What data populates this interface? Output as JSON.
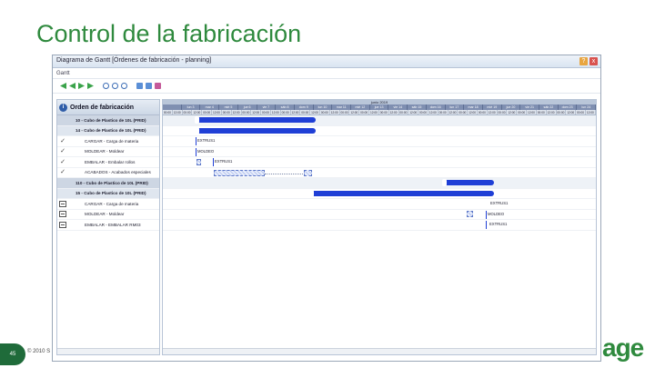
{
  "slide": {
    "title": "Control de la fabricación",
    "page_number": "45",
    "copyright": "© 2010 S",
    "logo_text": "age"
  },
  "window": {
    "title": "Diagrama de Gantt [Órdenes de fabricación - planning]",
    "menu": "Gantt",
    "buttons": {
      "help": "?",
      "close": "x"
    }
  },
  "toolbar": {
    "icons": [
      "first-icon",
      "prev-icon",
      "next-icon",
      "last-icon",
      "zoom-in-icon",
      "zoom-out-icon",
      "zoom-fit-icon",
      "settings-icon",
      "filter-icon",
      "print-icon"
    ]
  },
  "left_panel": {
    "header": "Orden de fabricación",
    "rows": [
      {
        "label": "10 - Cubo de Plastico de 10L (PRID)",
        "kind": "order",
        "icon": ""
      },
      {
        "label": "14 - Cubo de Plastico de 10L (PRID)",
        "kind": "sub",
        "icon": ""
      },
      {
        "label": "CARGAR - Carga de materia",
        "kind": "task",
        "icon": "✓"
      },
      {
        "label": "MOLDEAR - Moldear",
        "kind": "task",
        "icon": "✓"
      },
      {
        "label": "EMBALAR - Embalar rollos",
        "kind": "task",
        "icon": "✓"
      },
      {
        "label": "ACABADOS - Acabados especiales",
        "kind": "task",
        "icon": "✓"
      },
      {
        "label": "110 - Cubo de Plastico de 10L (PRID)",
        "kind": "order",
        "icon": ""
      },
      {
        "label": "15 - Cubo de Plastico de 10L (PRID)",
        "kind": "sub",
        "icon": ""
      },
      {
        "label": "CARGAR - Carga de materia",
        "kind": "task",
        "icon": "box"
      },
      {
        "label": "MOLDEAR - Moldear",
        "kind": "task",
        "icon": "box"
      },
      {
        "label": "EMBALAR - EMBALAR RM03",
        "kind": "task",
        "icon": "box"
      }
    ]
  },
  "timeline": {
    "month": "junio 2019",
    "days": [
      "",
      "lun 3",
      "mar 4",
      "mié 5",
      "jue 6",
      "vie 7",
      "sáb 8",
      "dom 9",
      "lun 10",
      "mar 11",
      "mié 12",
      "jue 13",
      "vie 14",
      "sáb 15",
      "dom 16",
      "lun 17",
      "mar 18",
      "mié 19",
      "jue 20",
      "vie 21",
      "sáb 22",
      "dom 23",
      "lun 24"
    ],
    "hours": [
      "00:00",
      "12:00",
      "00:00",
      "12:00",
      "00:00",
      "12:00",
      "00:00",
      "12:00",
      "00:00",
      "12:00",
      "00:00",
      "12:00",
      "00:00",
      "12:00",
      "00:00",
      "12:00",
      "00:00",
      "12:00",
      "00:00",
      "12:00",
      "00:00",
      "12:00",
      "00:00",
      "12:00",
      "00:00",
      "12:00",
      "00:00",
      "12:00",
      "00:00",
      "12:00",
      "00:00",
      "12:00",
      "00:00",
      "12:00",
      "00:00",
      "12:00",
      "00:00",
      "12:00",
      "00:00",
      "12:00",
      "00:00",
      "12:00",
      "00:00",
      "12:00"
    ]
  },
  "gantt_labels": {
    "r3": "EXTRUS1",
    "r4": "MOLDEO",
    "r5": "EXTRUS1",
    "r9": "EXTRUS1",
    "r10": "MOLDEO",
    "r11": "EXTRUS1"
  },
  "colors": {
    "accent": "#2f8a3e",
    "bar": "#1f3fd6",
    "header": "#7f8fb1"
  }
}
